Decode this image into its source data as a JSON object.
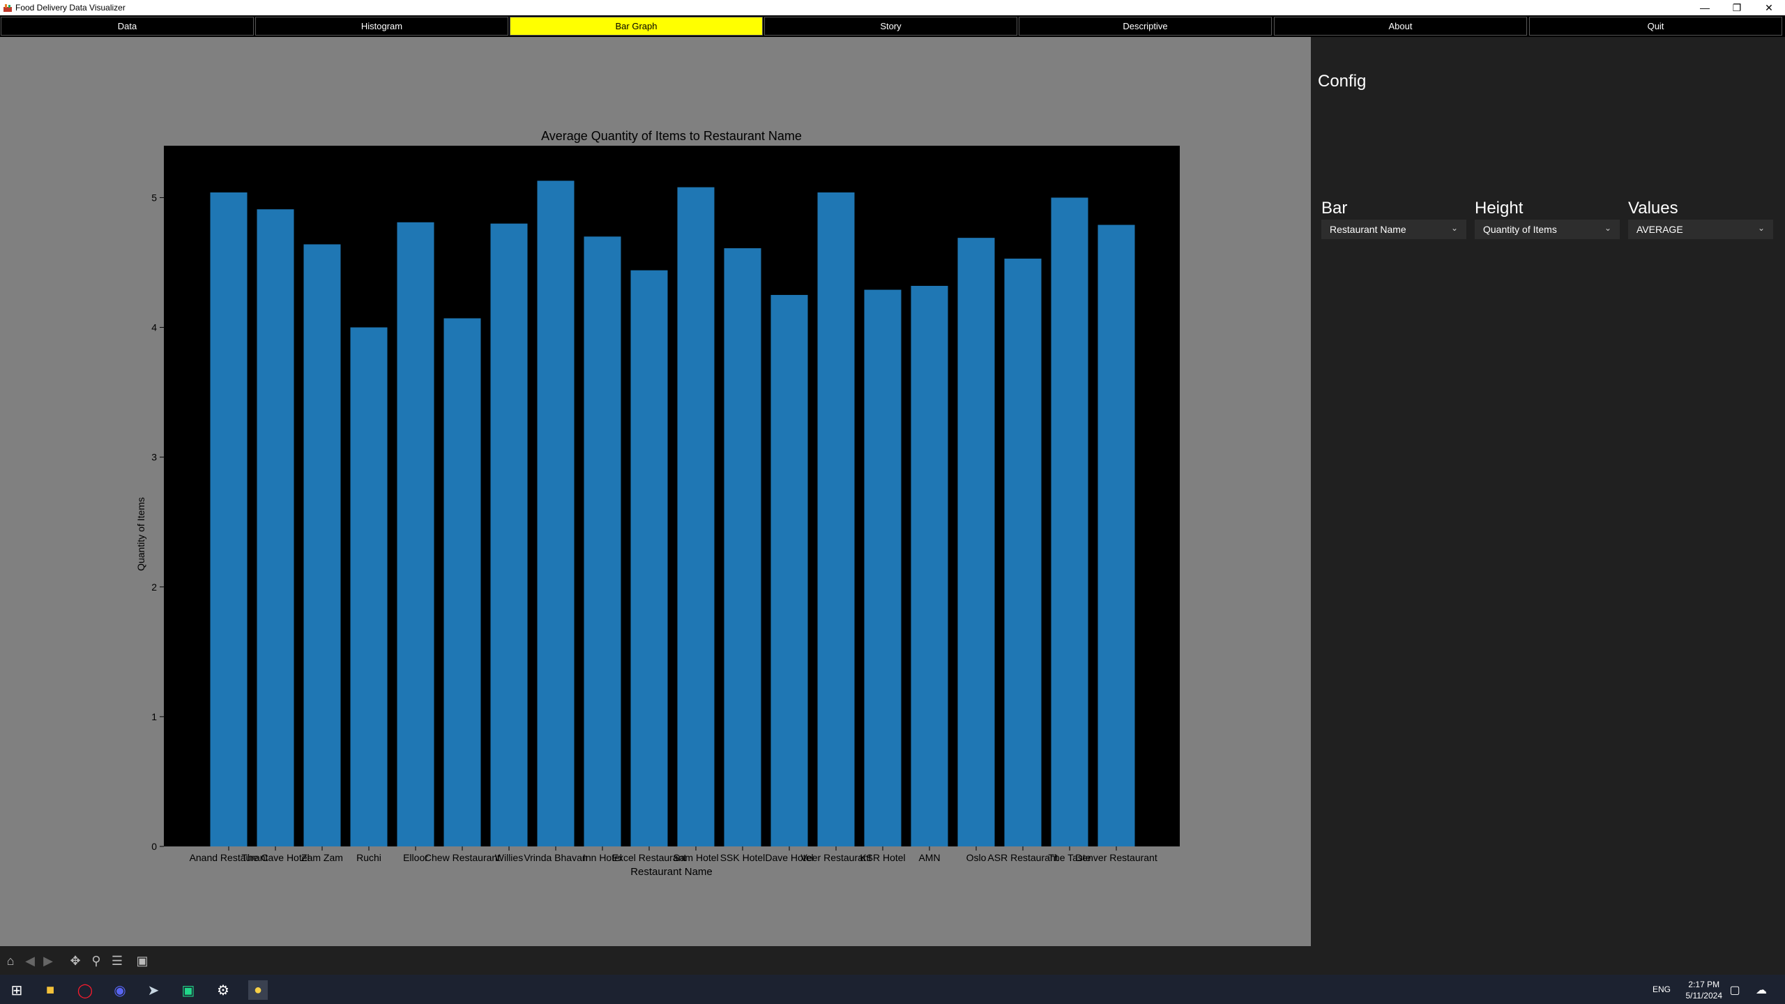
{
  "window": {
    "title": "Food Delivery Data Visualizer",
    "minimize_icon": "minimize-icon",
    "restore_icon": "restore-icon",
    "close_icon": "close-icon"
  },
  "tabs": [
    {
      "label": "Data",
      "active": false
    },
    {
      "label": "Histogram",
      "active": false
    },
    {
      "label": "Bar Graph",
      "active": true
    },
    {
      "label": "Story",
      "active": false
    },
    {
      "label": "Descriptive",
      "active": false
    },
    {
      "label": "About",
      "active": false
    },
    {
      "label": "Quit",
      "active": false
    }
  ],
  "config": {
    "title": "Config",
    "bar": {
      "label": "Bar",
      "value": "Restaurant Name"
    },
    "height": {
      "label": "Height",
      "value": "Quantity of Items"
    },
    "values": {
      "label": "Values",
      "value": "AVERAGE"
    }
  },
  "toolbar": {
    "icons": [
      "home-icon",
      "back-icon",
      "forward-icon",
      "pan-icon",
      "zoom-icon",
      "configure-subplots-icon",
      "save-icon"
    ]
  },
  "taskbar": {
    "language": "ENG",
    "time": "2:17 PM",
    "date": "5/11/2024",
    "icons": [
      "windows-start-icon",
      "file-explorer-icon",
      "opera-icon",
      "discord-icon",
      "steam-icon",
      "pycharm-icon",
      "settings-icon",
      "python-icon"
    ]
  },
  "colors": {
    "accent_tab": "#ffff00",
    "bar_fill": "#1f77b4",
    "plot_bg": "#000000",
    "figure_bg": "#808080"
  },
  "chart_data": {
    "type": "bar",
    "title": "Average Quantity of Items to Restaurant Name",
    "xlabel": "Restaurant Name",
    "ylabel": "Quantity of Items",
    "ylim": [
      0,
      5.4
    ],
    "yticks": [
      0,
      1,
      2,
      3,
      4,
      5
    ],
    "grid": false,
    "categories": [
      "Anand Restaurant",
      "The Cave Hotel",
      "Zam Zam",
      "Ruchi",
      "Elloor",
      "Chew Restaurant",
      "Willies",
      "Vrinda Bhavan",
      "Inn Hotel",
      "Excel Restaurant",
      "Sam Hotel",
      "SSK Hotel",
      "Dave Hotel",
      "Veer Restaurant",
      "KSR Hotel",
      "AMN",
      "Oslo",
      "ASR Restaurant",
      "The Taste",
      "Denver Restaurant"
    ],
    "values": [
      5.04,
      4.91,
      4.64,
      4.0,
      4.81,
      4.07,
      4.8,
      5.13,
      4.7,
      4.44,
      5.08,
      4.61,
      4.25,
      5.04,
      4.29,
      4.32,
      4.69,
      4.53,
      5.0,
      4.79
    ]
  }
}
